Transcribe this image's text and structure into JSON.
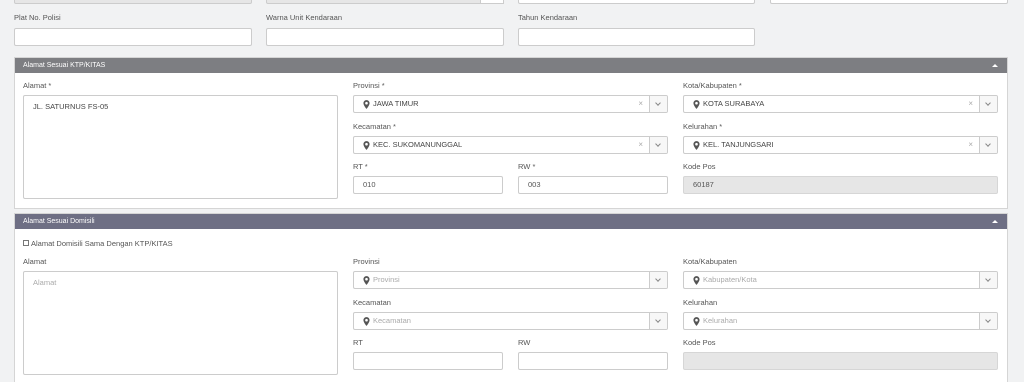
{
  "vehicle": {
    "plate_label": "Plat No. Polisi",
    "plate_value": "",
    "color_label": "Warna Unit Kendaraan",
    "color_value": "",
    "year_label": "Tahun Kendaraan",
    "year_value": ""
  },
  "ktp_section": {
    "title": "Alamat Sesuai KTP/KITAS",
    "address_label": "Alamat *",
    "address_value": "JL. SATURNUS FS-05",
    "province_label": "Provinsi *",
    "province_value": "JAWA TIMUR",
    "city_label": "Kota/Kabupaten *",
    "city_value": "KOTA SURABAYA",
    "district_label": "Kecamatan *",
    "district_value": "KEC. SUKOMANUNGGAL",
    "village_label": "Kelurahan *",
    "village_value": "KEL. TANJUNGSARI",
    "rt_label": "RT *",
    "rt_value": "010",
    "rw_label": "RW *",
    "rw_value": "003",
    "postal_label": "Kode Pos",
    "postal_value": "60187",
    "clear_symbol": "×"
  },
  "domicile_section": {
    "title": "Alamat Sesuai Domisili",
    "same_checkbox_label": "Alamat Domisili Sama Dengan KTP/KITAS",
    "same_checked": false,
    "address_label": "Alamat",
    "address_placeholder": "Alamat",
    "province_label": "Provinsi",
    "province_placeholder": "Provinsi",
    "city_label": "Kota/Kabupaten",
    "city_placeholder": "Kabupaten/Kota",
    "district_label": "Kecamatan",
    "district_placeholder": "Kecamatan",
    "village_label": "Kelurahan",
    "village_placeholder": "Kelurahan",
    "rt_label": "RT",
    "rt_value": "",
    "rw_label": "RW",
    "rw_value": "",
    "postal_label": "Kode Pos",
    "postal_value": ""
  },
  "colors": {
    "panel_header": "#7d7e82",
    "header_selected": "#6e6f84",
    "background": "#f1f2f3"
  }
}
